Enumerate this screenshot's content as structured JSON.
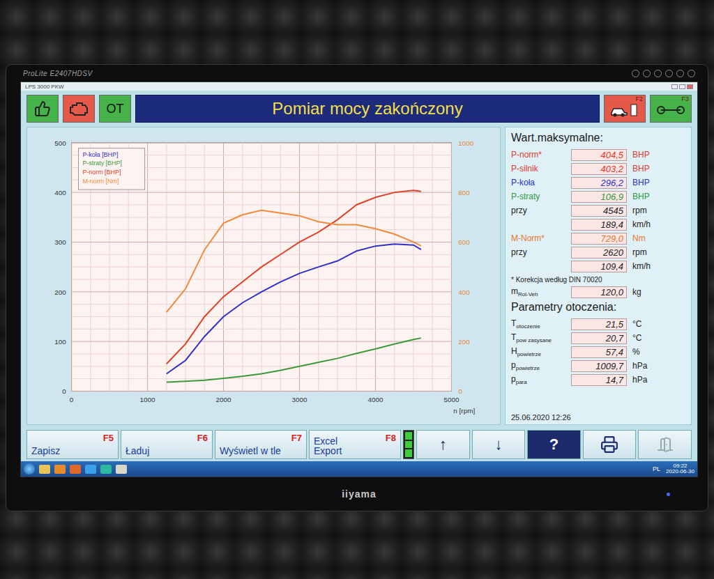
{
  "monitor": {
    "model": "ProLite E2407HDSV",
    "brand": "iiyama"
  },
  "window": {
    "title": "LPS 3000 PKW"
  },
  "header": {
    "left": [
      {
        "kind": "thumb",
        "color": "#46b34a"
      },
      {
        "kind": "engine",
        "color": "#e5594b"
      },
      {
        "kind": "text",
        "label": "OT",
        "color": "#46b34a"
      }
    ],
    "title": "Pomiar mocy zakończony",
    "right": [
      {
        "kind": "car",
        "fkey": "F2",
        "color": "#e5594b"
      },
      {
        "kind": "trailer",
        "fkey": "F3",
        "color": "#46b34a"
      }
    ]
  },
  "chart": {
    "x_ticks": [
      "0",
      "1000",
      "2000",
      "3000",
      "4000",
      "5000"
    ],
    "x_label": "n [rpm]",
    "y_left_ticks": [
      "0",
      "100",
      "200",
      "300",
      "400",
      "500"
    ],
    "y_right_ticks": [
      "0",
      "200",
      "400",
      "600",
      "800",
      "1000"
    ],
    "rpm": [
      1250,
      1500,
      1750,
      2000,
      2250,
      2500,
      2750,
      3000,
      3250,
      3500,
      3750,
      4000,
      4250,
      4500,
      4600
    ],
    "series": [
      {
        "name": "P-koła [BHP]",
        "axis": "left",
        "color": "#3030c8",
        "values": [
          35,
          62,
          110,
          150,
          178,
          200,
          220,
          237,
          250,
          262,
          282,
          292,
          296,
          294,
          285
        ]
      },
      {
        "name": "P-straty [BHP]",
        "axis": "left",
        "color": "#3a9a3a",
        "values": [
          18,
          20,
          22,
          26,
          30,
          35,
          42,
          50,
          58,
          66,
          76,
          85,
          95,
          104,
          107
        ]
      },
      {
        "name": "P-norm [BHP]",
        "axis": "left",
        "color": "#e0402a",
        "values": [
          55,
          95,
          150,
          190,
          220,
          250,
          275,
          300,
          320,
          345,
          375,
          390,
          400,
          404,
          402
        ]
      },
      {
        "name": "M-norm [Nm]",
        "axis": "right",
        "color": "#f08a3c",
        "values": [
          318,
          412,
          569,
          676,
          710,
          728,
          717,
          706,
          682,
          670,
          670,
          654,
          632,
          600,
          585
        ]
      }
    ]
  },
  "values": {
    "title": "Wart.maksymalne:",
    "rows": [
      {
        "label": "P-norm*",
        "value": "404,5",
        "unit": "BHP",
        "color": "#e03a2a"
      },
      {
        "label": "P-silnik",
        "value": "403,2",
        "unit": "BHP",
        "color": "#e03a2a"
      },
      {
        "label": "P-koła",
        "value": "296,2",
        "unit": "BHP",
        "color": "#2a35c8"
      },
      {
        "label": "P-straty",
        "value": "106,9",
        "unit": "BHP",
        "color": "#2f9a3a"
      },
      {
        "label": "przy",
        "value": "4545",
        "unit": "rpm",
        "color": "#222222"
      },
      {
        "label": "",
        "value": "189,4",
        "unit": "km/h",
        "color": "#222222"
      },
      {
        "label": "M-Norm*",
        "value": "729,0",
        "unit": "Nm",
        "color": "#e8782a"
      },
      {
        "label": "przy",
        "value": "2620",
        "unit": "rpm",
        "color": "#222222"
      },
      {
        "label": "",
        "value": "109,4",
        "unit": "km/h",
        "color": "#222222"
      }
    ],
    "note": "* Korekcja według DIN 70020",
    "mass": {
      "label": "m",
      "sub": "Rol-Veh",
      "value": "120,0",
      "unit": "kg"
    },
    "env_title": "Parametry otoczenia:",
    "env": [
      {
        "label": "T",
        "sub": "otoczenie",
        "value": "21,5",
        "unit": "°C"
      },
      {
        "label": "T",
        "sub": "pow zasysane",
        "value": "20,7",
        "unit": "°C"
      },
      {
        "label": "H",
        "sub": "powietrze",
        "value": "57,4",
        "unit": "%"
      },
      {
        "label": "p",
        "sub": "powietrze",
        "value": "1009,7",
        "unit": "hPa"
      },
      {
        "label": "p",
        "sub": "para",
        "value": "14,7",
        "unit": "hPa"
      }
    ],
    "date": "25.06.2020  12:26"
  },
  "buttons": [
    {
      "label": "Zapisz",
      "fkey": "F5",
      "kind": "plain"
    },
    {
      "label": "Ładuj",
      "fkey": "F6",
      "kind": "plain"
    },
    {
      "label": "Wyświetl w tle",
      "fkey": "F7",
      "kind": "plain"
    },
    {
      "label": "Excel Export",
      "fkey": "F8",
      "kind": "stacked"
    }
  ],
  "status_led": {
    "on": true
  },
  "tools": [
    {
      "kind": "text",
      "label": "↑",
      "disabled": false
    },
    {
      "kind": "text",
      "label": "↓",
      "disabled": false
    },
    {
      "kind": "help",
      "label": "?",
      "disabled": false
    },
    {
      "kind": "printer",
      "disabled": false
    },
    {
      "kind": "exit",
      "disabled": true
    }
  ],
  "taskbar": {
    "lang": "PL",
    "time": "09:22",
    "date": "2020-06-30"
  }
}
